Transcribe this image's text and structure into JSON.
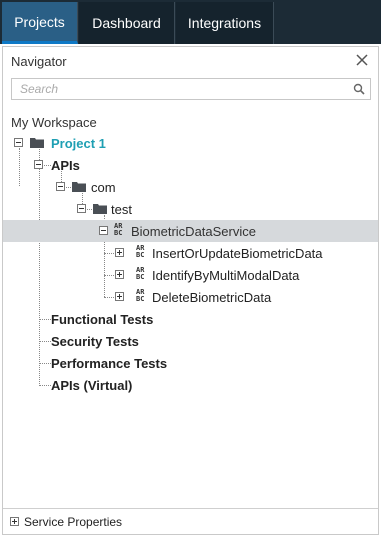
{
  "tabs": [
    {
      "label": "Projects",
      "active": true
    },
    {
      "label": "Dashboard",
      "active": false
    },
    {
      "label": "Integrations",
      "active": false
    }
  ],
  "navigator": {
    "title": "Navigator",
    "search_placeholder": "Search",
    "workspace_label": "My Workspace"
  },
  "tree": {
    "project": "Project 1",
    "apis": "APIs",
    "com": "com",
    "test": "test",
    "service": "BiometricDataService",
    "operations": [
      "InsertOrUpdateBiometricData",
      "IdentifyByMultiModalData",
      "DeleteBiometricData"
    ],
    "functional_tests": "Functional Tests",
    "security_tests": "Security Tests",
    "performance_tests": "Performance Tests",
    "apis_virtual": "APIs (Virtual)"
  },
  "footer": {
    "service_properties": "Service Properties"
  },
  "colors": {
    "topbar": "#1c2b36",
    "active_tab": "#2a5f86",
    "project_text": "#1e9fb3",
    "selected_row": "#d6d9dc"
  }
}
